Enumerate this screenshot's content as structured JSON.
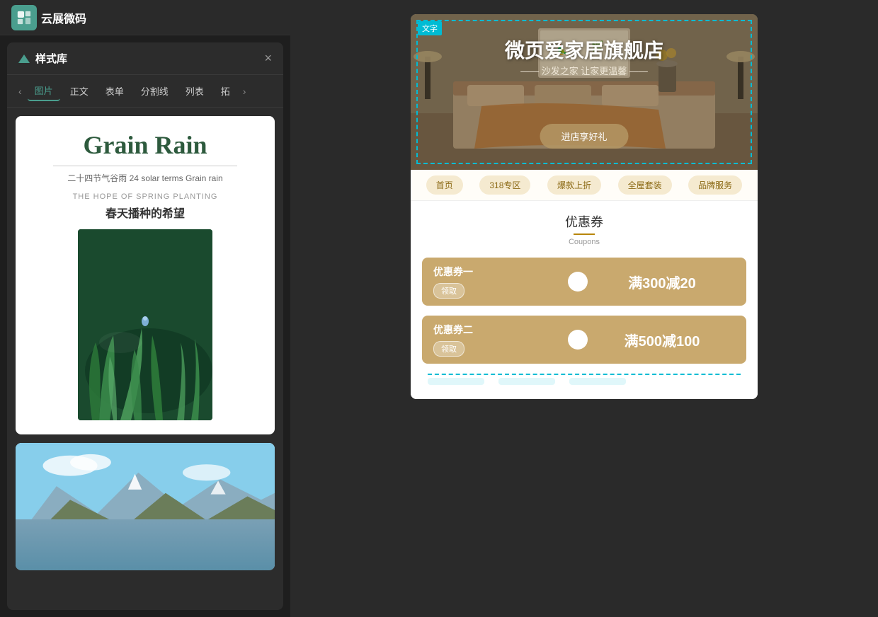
{
  "app": {
    "logo_text": "云展微码",
    "logo_icon": "☁"
  },
  "styles_panel": {
    "title": "样式库",
    "close_label": "×",
    "tabs": [
      {
        "label": "图片",
        "active": true
      },
      {
        "label": "正文",
        "active": false
      },
      {
        "label": "表单",
        "active": false
      },
      {
        "label": "分割线",
        "active": false
      },
      {
        "label": "列表",
        "active": false
      },
      {
        "label": "拓",
        "active": false
      }
    ],
    "prev_arrow": "‹",
    "next_arrow": "›"
  },
  "card1": {
    "title": "Grain Rain",
    "subtitle": "二十四节气谷雨 24  solar terms Grain rain",
    "english_label": "THE HOPE OF SPRING PLANTING",
    "chinese_label": "春天播种的希望"
  },
  "preview": {
    "selection_label": "文字",
    "hero_title": "微页爱家居旗舰店",
    "hero_subtitle": "—— 沙发之家 让家更温馨 ——",
    "hero_button": "进店享好礼",
    "nav_tabs": [
      "首页",
      "318专区",
      "爆款上折",
      "全屋套装",
      "品牌服务"
    ],
    "coupons_title": "优惠券",
    "coupons_title_en": "Coupons",
    "coupon1_name": "优惠券一",
    "coupon1_btn": "领取",
    "coupon1_value": "满300减20",
    "coupon2_name": "优惠券二",
    "coupon2_btn": "领取",
    "coupon2_value": "满500减100"
  }
}
